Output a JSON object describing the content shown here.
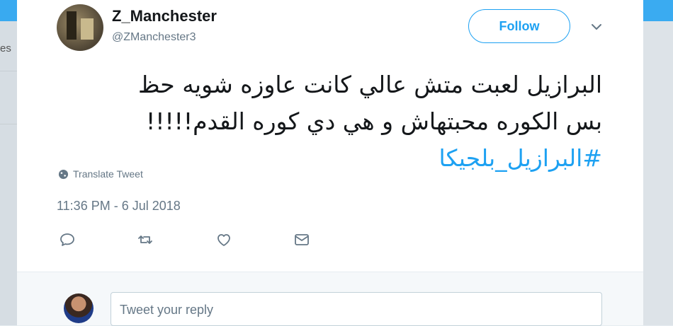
{
  "tweet": {
    "author_name": "Z_Manchester",
    "author_handle": "@ZManchester3",
    "follow_label": "Follow",
    "text_lines": [
      "البرازيل لعبت متش عالي كانت عاوزه شويه حظ",
      "بس الكوره محبتهاش و هي دي كوره القدم!!!!!"
    ],
    "hashtag": "#البرازيل_بلجيكا",
    "translate_label": "Translate Tweet",
    "timestamp": "11:36 PM - 6 Jul 2018"
  },
  "actions": [
    {
      "icon": "reply-icon"
    },
    {
      "icon": "retweet-icon"
    },
    {
      "icon": "like-icon"
    },
    {
      "icon": "direct-message-icon"
    }
  ],
  "reply": {
    "placeholder": "Tweet your reply"
  },
  "background": {
    "left_fragment_text": "es"
  },
  "colors": {
    "accent": "#1da1f2",
    "secondary_text": "#657786",
    "primary_text": "#14171a"
  }
}
